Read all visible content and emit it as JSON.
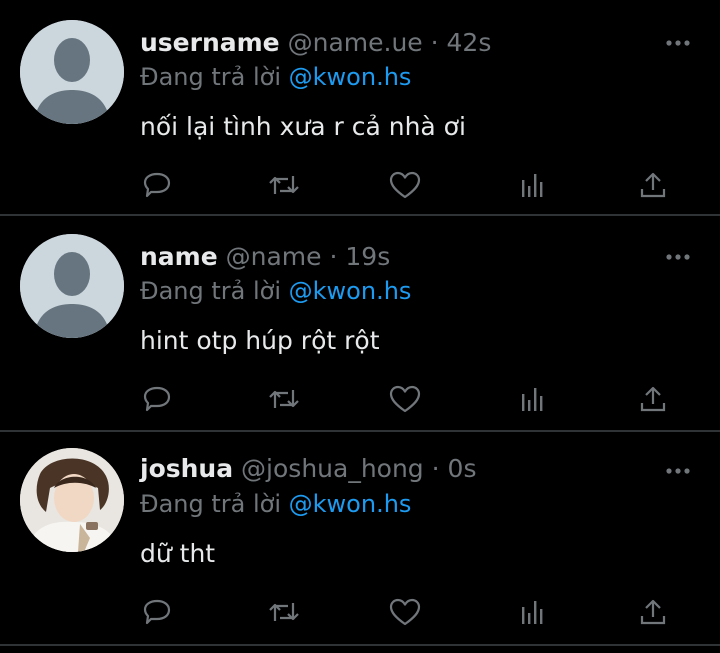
{
  "colors": {
    "background": "#000000",
    "text": "#e7e9ea",
    "muted": "#71767b",
    "accent": "#1d9bf0",
    "divider": "#2f3336"
  },
  "tweets": [
    {
      "display_name": "username",
      "handle": "@name.ue",
      "separator": "·",
      "time": "42s",
      "reply_prefix": "Đang trả lời",
      "reply_to": "@kwon.hs",
      "text": "nối lại tình xưa r cả nhà ơi",
      "avatar": "default-avatar-icon"
    },
    {
      "display_name": "name",
      "handle": "@name",
      "separator": "·",
      "time": "19s",
      "reply_prefix": "Đang trả lời",
      "reply_to": "@kwon.hs",
      "text": "hint otp húp rột rột",
      "avatar": "default-avatar-icon"
    },
    {
      "display_name": "joshua",
      "handle": "@joshua_hong",
      "separator": "·",
      "time": "0s",
      "reply_prefix": "Đang trả lời",
      "reply_to": "@kwon.hs",
      "text": "dữ tht",
      "avatar": "profile-photo"
    }
  ],
  "action_icons": [
    "reply-icon",
    "retweet-icon",
    "like-icon",
    "views-icon",
    "share-icon"
  ],
  "more_icon": "more-options-icon"
}
